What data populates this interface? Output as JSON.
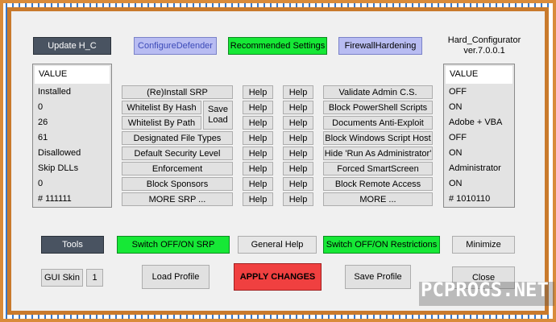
{
  "app_title_line1": "Hard_Configurator",
  "app_title_line2": "ver.7.0.0.1",
  "top_buttons": {
    "update": "Update H_C",
    "configure_defender": "ConfigureDefender",
    "recommended": "Recommended Settings",
    "firewall": "FirewallHardening"
  },
  "left_values": {
    "header": "VALUE",
    "items": [
      "Installed",
      "0",
      "26",
      "61",
      "Disallowed",
      "Skip DLLs",
      "0",
      "# 111111"
    ]
  },
  "right_values": {
    "header": "VALUE",
    "items": [
      "OFF",
      "ON",
      "Adobe + VBA",
      "OFF",
      "ON",
      "Administrator",
      "ON",
      "# 1010110"
    ]
  },
  "srp_buttons": {
    "reinstall": "(Re)Install SRP",
    "whitelist_hash": "Whitelist By Hash",
    "whitelist_path": "Whitelist By Path",
    "save": "Save",
    "load": "Load",
    "file_types": "Designated File Types",
    "security_level": "Default Security Level",
    "enforcement": "Enforcement",
    "block_sponsors": "Block Sponsors",
    "more_srp": "MORE SRP ..."
  },
  "help_label": "Help",
  "restriction_buttons": {
    "validate": "Validate Admin C.S.",
    "powershell": "Block PowerShell Scripts",
    "documents": "Documents Anti-Exploit",
    "wsh": "Block Windows Script Host",
    "run_as_admin": "Hide  'Run As Administrator'",
    "smartscreen": "Forced SmartScreen",
    "remote_access": "Block Remote Access",
    "more": "MORE ..."
  },
  "bottom": {
    "tools": "Tools",
    "switch_srp": "Switch OFF/ON SRP",
    "general_help": "General Help",
    "switch_restrictions": "Switch OFF/ON Restrictions",
    "minimize": "Minimize",
    "gui_skin": "GUI Skin",
    "skin_number": "1",
    "load_profile": "Load Profile",
    "apply": "APPLY CHANGES",
    "save_profile": "Save Profile",
    "close": "Close"
  },
  "watermark": "PCPROGS.NET",
  "colors": {
    "frame": "#c97a2c",
    "green": "#16e836",
    "red": "#f04040",
    "lavender": "#b8bcf2",
    "dark": "#495361"
  }
}
